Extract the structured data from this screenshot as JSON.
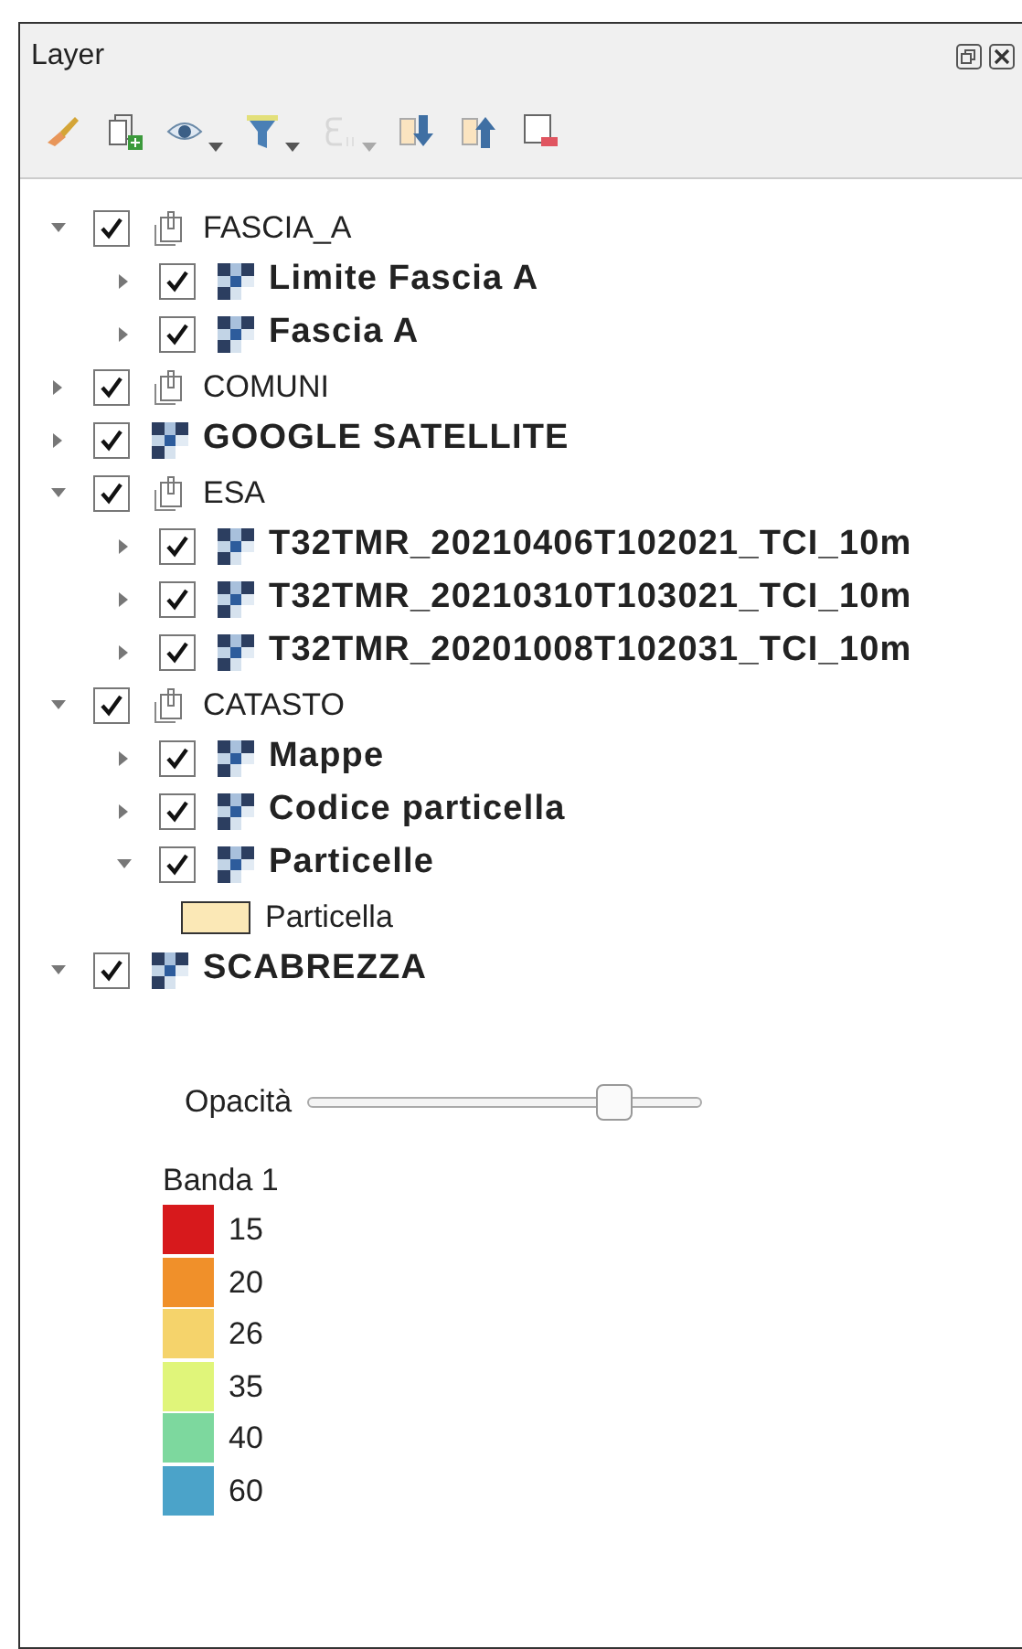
{
  "panel": {
    "title": "Layer"
  },
  "toolbar": [
    {
      "kind": "style",
      "disabled": false,
      "dropdown": false
    },
    {
      "kind": "add-group",
      "disabled": false,
      "dropdown": false
    },
    {
      "kind": "visibility",
      "disabled": false,
      "dropdown": true
    },
    {
      "kind": "filter",
      "disabled": false,
      "dropdown": true
    },
    {
      "kind": "expression",
      "disabled": true,
      "dropdown": true
    },
    {
      "kind": "expand",
      "disabled": false,
      "dropdown": false
    },
    {
      "kind": "collapse",
      "disabled": false,
      "dropdown": false
    },
    {
      "kind": "remove",
      "disabled": false,
      "dropdown": false
    }
  ],
  "tree": [
    {
      "kind": "group",
      "label": "FASCIA_A",
      "expanded": true,
      "checked": true,
      "children": [
        {
          "kind": "raster",
          "label": "Limite Fascia A",
          "expanded": false,
          "checked": true
        },
        {
          "kind": "raster",
          "label": "Fascia A",
          "expanded": false,
          "checked": true
        }
      ]
    },
    {
      "kind": "group",
      "label": "COMUNI",
      "expanded": false,
      "checked": true
    },
    {
      "kind": "raster",
      "label": "GOOGLE SATELLITE",
      "expanded": false,
      "checked": true
    },
    {
      "kind": "group",
      "label": "ESA",
      "expanded": true,
      "checked": true,
      "children": [
        {
          "kind": "raster",
          "label": "T32TMR_20210406T102021_TCI_10m",
          "expanded": false,
          "checked": true
        },
        {
          "kind": "raster",
          "label": "T32TMR_20210310T103021_TCI_10m",
          "expanded": false,
          "checked": true
        },
        {
          "kind": "raster",
          "label": "T32TMR_20201008T102031_TCI_10m",
          "expanded": false,
          "checked": true
        }
      ]
    },
    {
      "kind": "group",
      "label": "CATASTO",
      "expanded": true,
      "checked": true,
      "children": [
        {
          "kind": "raster",
          "label": "Mappe",
          "expanded": false,
          "checked": true
        },
        {
          "kind": "raster",
          "label": "Codice particella",
          "expanded": false,
          "checked": true
        },
        {
          "kind": "raster",
          "label": "Particelle",
          "expanded": true,
          "checked": true,
          "children": [
            {
              "kind": "symbol",
              "label": "Particella"
            }
          ]
        }
      ]
    },
    {
      "kind": "raster",
      "label": "SCABREZZA",
      "expanded": true,
      "checked": true,
      "opacity": {
        "label": "Opacità",
        "level": 0.78
      },
      "legend": {
        "title": "Banda 1",
        "items": [
          {
            "label": "15",
            "color": "#d7191c"
          },
          {
            "label": "20",
            "color": "#f0902a"
          },
          {
            "label": "26",
            "color": "#f5d36b"
          },
          {
            "label": "35",
            "color": "#e0f57a"
          },
          {
            "label": "40",
            "color": "#7dd89e"
          },
          {
            "label": "60",
            "color": "#4ba3c9"
          }
        ]
      }
    }
  ]
}
